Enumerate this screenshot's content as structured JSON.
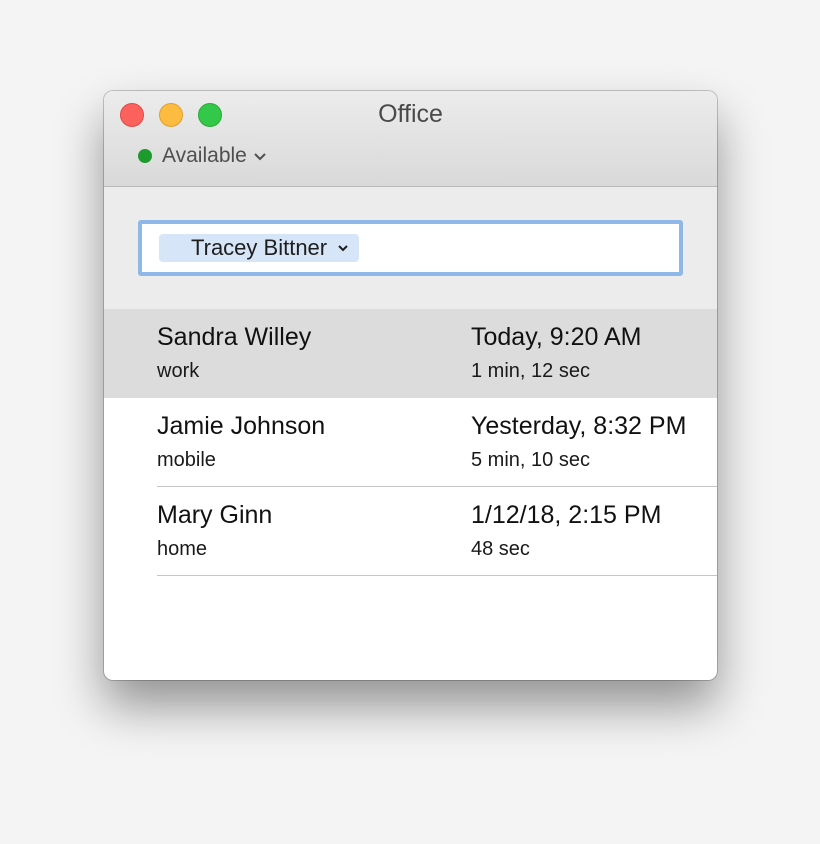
{
  "window": {
    "title": "Office"
  },
  "status": {
    "label": "Available",
    "color": "#1f9a2d",
    "icon": "chevron-down-icon"
  },
  "search": {
    "token": "Tracey Bittner",
    "token_icon": "chevron-down-icon",
    "focus_color": "#8fb8e8"
  },
  "calls": [
    {
      "name": "Sandra Willey",
      "label": "work",
      "time": "Today, 9:20 AM",
      "duration": "1 min, 12 sec",
      "selected": true
    },
    {
      "name": "Jamie Johnson",
      "label": "mobile",
      "time": "Yesterday, 8:32 PM",
      "duration": "5 min, 10 sec",
      "selected": false
    },
    {
      "name": "Mary Ginn",
      "label": "home",
      "time": "1/12/18, 2:15 PM",
      "duration": "48 sec",
      "selected": false
    }
  ]
}
